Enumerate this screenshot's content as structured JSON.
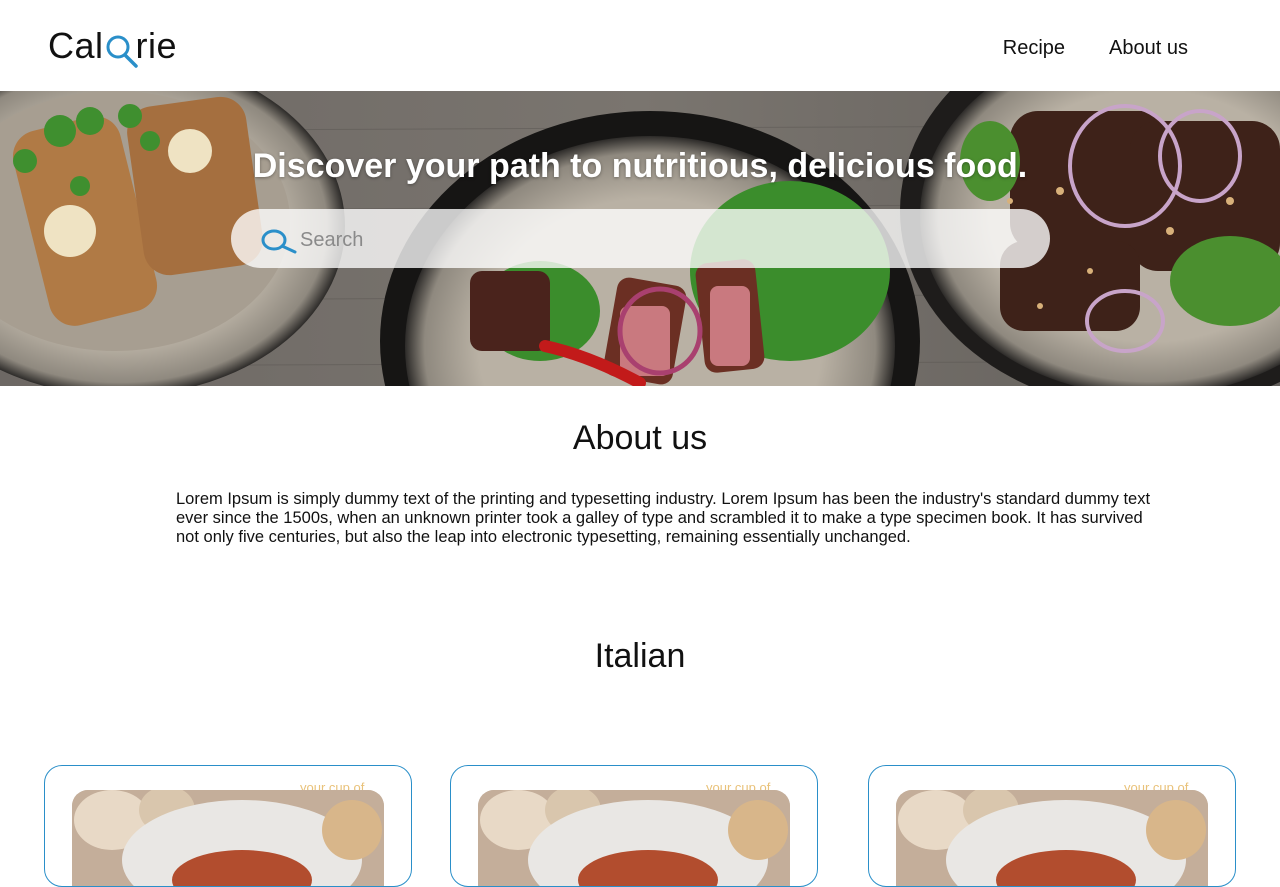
{
  "header": {
    "logo": {
      "left": "Cal",
      "right": "rie",
      "icon": "magnifier-icon"
    },
    "nav": [
      {
        "label": "Recipe"
      },
      {
        "label": "About us"
      }
    ]
  },
  "hero": {
    "title": "Discover your path to nutritious, delicious food.",
    "search": {
      "placeholder": "Search",
      "value": "",
      "icon": "search-icon"
    }
  },
  "about": {
    "title": "About us",
    "text": "Lorem Ipsum is simply dummy text of the printing and typesetting industry. Lorem Ipsum has been the industry's standard dummy text ever since the 1500s, when an unknown printer took a galley of type and scrambled it to make a type specimen book. It has survived not only five centuries, but also the leap into electronic typesetting, remaining essentially unchanged."
  },
  "section": {
    "title": "Italian"
  },
  "cards": [
    {
      "caption": "your cup of"
    },
    {
      "caption": "your cup of"
    },
    {
      "caption": "your cup of"
    }
  ],
  "colors": {
    "accent": "#2a8fc9",
    "text": "#111111",
    "hero_text": "#ffffff"
  }
}
